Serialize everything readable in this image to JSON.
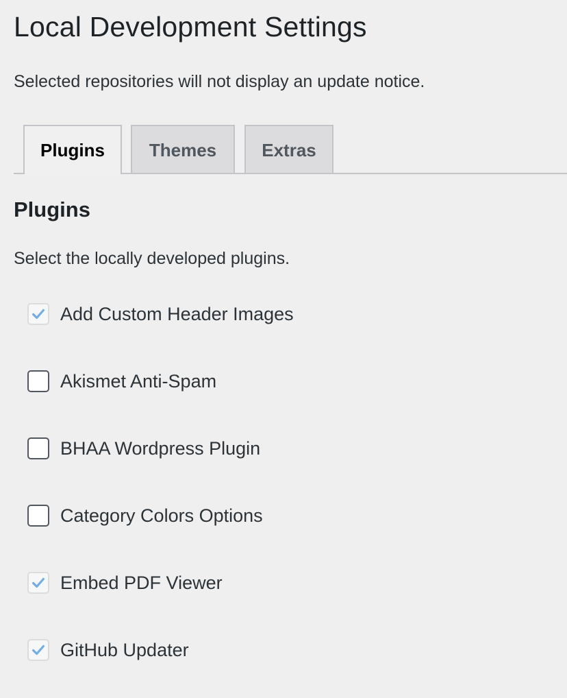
{
  "page": {
    "title": "Local Development Settings",
    "intro": "Selected repositories will not display an update notice."
  },
  "tabs": [
    {
      "label": "Plugins",
      "active": true
    },
    {
      "label": "Themes",
      "active": false
    },
    {
      "label": "Extras",
      "active": false
    }
  ],
  "section": {
    "title": "Plugins",
    "description": "Select the locally developed plugins."
  },
  "plugins": [
    {
      "label": "Add Custom Header Images",
      "checked": true
    },
    {
      "label": "Akismet Anti-Spam",
      "checked": false
    },
    {
      "label": "BHAA Wordpress Plugin",
      "checked": false
    },
    {
      "label": "Category Colors Options",
      "checked": false
    },
    {
      "label": "Embed PDF Viewer",
      "checked": true
    },
    {
      "label": "GitHub Updater",
      "checked": true
    }
  ],
  "colors": {
    "background": "#efefef",
    "checkmark": "#72aee6",
    "checkbox_border": "#50575e",
    "tab_border": "#c3c4c7"
  },
  "icons": {
    "checkmark": "checkmark-icon"
  }
}
